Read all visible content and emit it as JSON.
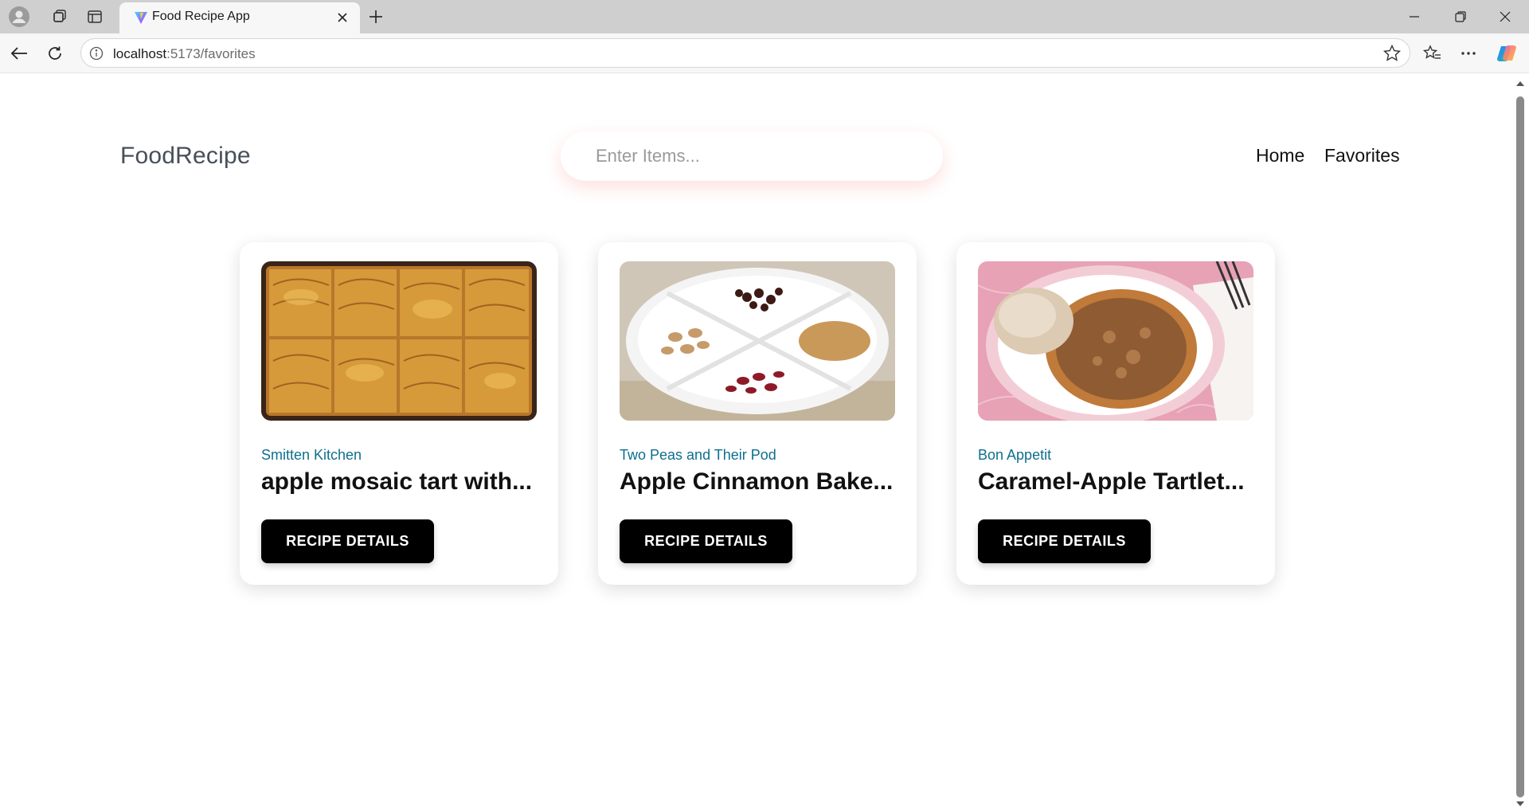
{
  "browser": {
    "tab_title": "Food Recipe App",
    "url_host": "localhost",
    "url_path": ":5173/favorites"
  },
  "header": {
    "brand": "FoodRecipe",
    "search_placeholder": "Enter Items...",
    "nav": {
      "home": "Home",
      "favorites": "Favorites"
    }
  },
  "recipes": [
    {
      "publisher": "Smitten Kitchen",
      "title": "apple mosaic tart with...",
      "button": "RECIPE DETAILS"
    },
    {
      "publisher": "Two Peas and Their Pod",
      "title": "Apple Cinnamon Bake...",
      "button": "RECIPE DETAILS"
    },
    {
      "publisher": "Bon Appetit",
      "title": "Caramel-Apple Tartlet...",
      "button": "RECIPE DETAILS"
    }
  ],
  "colors": {
    "brand_text": "#474f5a",
    "publisher_text": "#0e6f8e",
    "button_bg": "#000000",
    "search_shadow": "#ff6e6e"
  }
}
